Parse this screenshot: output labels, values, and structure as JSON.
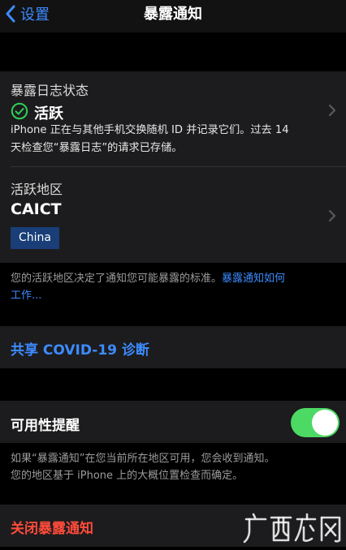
{
  "nav": {
    "back_label": "设置",
    "title": "暴露通知"
  },
  "status_section": {
    "label": "暴露日志状态",
    "status_text": "活跃",
    "description_line1": "iPhone 正在与其他手机交换随机 ID 并记录它们。过去 14",
    "description_line2": "天检查您“暴露日志”的请求已存储。"
  },
  "region_section": {
    "label": "活跃地区",
    "name": "CAICT",
    "badge": "China"
  },
  "region_note": {
    "text": "您的活跃地区决定了通知您可能暴露的标准。",
    "link_part1": "暴露通知如何",
    "link_part2": "工作..."
  },
  "share": {
    "label": "共享 COVID-19 诊断"
  },
  "availability": {
    "label": "可用性提醒",
    "enabled": true,
    "note_line1": "如果“暴露通知”在您当前所在地区可用，您会收到通知。",
    "note_line2": "您的地区基于 iPhone 上的大概位置检查而确定。"
  },
  "turn_off": {
    "label": "关闭暴露通知"
  },
  "watermark": {
    "text": "广西龙网"
  },
  "colors": {
    "accent_blue": "#3d8bff",
    "destructive_red": "#ff4b3a",
    "toggle_green": "#4cd964",
    "status_green": "#30d158",
    "badge_blue": "#193e78",
    "cell_bg": "#1c1c1e"
  },
  "icons": {
    "back": "chevron-left-icon",
    "status": "checkmark-circle-icon",
    "disclosure": "chevron-right-icon"
  }
}
